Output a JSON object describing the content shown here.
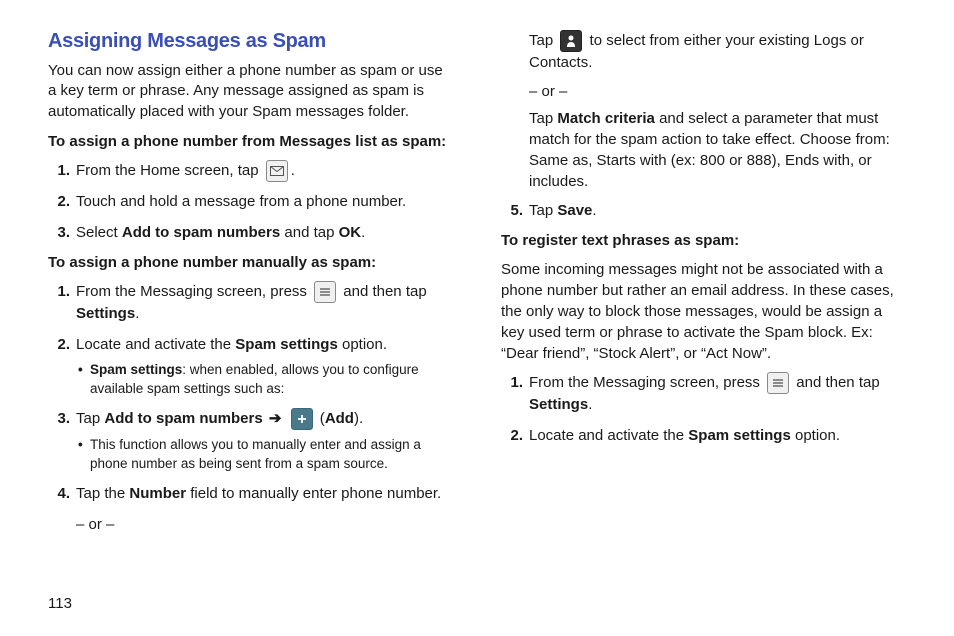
{
  "heading": "Assigning Messages as Spam",
  "intro": "You can now assign either a phone number as spam or use a key term or phrase. Any message assigned as spam is automatically placed with your Spam messages folder.",
  "sub1": "To assign a phone number from Messages list as spam:",
  "s1_1a": "From the Home screen, tap ",
  "s1_1b": ".",
  "s1_2": "Touch and hold a message from a phone number.",
  "s1_3a": "Select ",
  "s1_3b": "Add to spam numbers",
  "s1_3c": " and tap ",
  "s1_3d": "OK",
  "s1_3e": ".",
  "sub2": "To assign a phone number manually as spam:",
  "s2_1a": "From the Messaging screen, press ",
  "s2_1b": " and then tap ",
  "s2_1c": "Settings",
  "s2_1d": ".",
  "s2_2a": "Locate and activate the ",
  "s2_2b": "Spam settings",
  "s2_2c": " option.",
  "s2_2_bul_a": "Spam settings",
  "s2_2_bul_b": ": when enabled, allows you to configure available spam settings such as:",
  "s2_3a": "Tap ",
  "s2_3b": "Add to spam numbers",
  "s2_3c": " ",
  "s2_3arrow": "➔",
  "s2_3d": " (",
  "s2_3e": "Add",
  "s2_3f": ").",
  "s2_3_bul": "This function allows you to manually enter and assign a phone number as being sent from a spam source.",
  "s2_4a": "Tap the ",
  "s2_4b": "Number",
  "s2_4c": " field to manually enter phone number.",
  "or": "– or –",
  "s2_4d": "Tap ",
  "s2_4e": " to select from either your existing Logs or Contacts.",
  "s2_4f": "Tap ",
  "s2_4g": "Match criteria",
  "s2_4h": " and select a parameter that must match for the spam action to take effect. Choose from: Same as, Starts with (ex: 800 or 888), Ends with, or includes.",
  "s2_5a": "Tap ",
  "s2_5b": "Save",
  "s2_5c": ".",
  "sub3": "To register text phrases as spam:",
  "body3": "Some incoming messages might not be associated with a phone number but rather an email address. In these cases, the only way to block those messages, would be assign a key used term or phrase to activate the Spam block. Ex: “Dear friend”, “Stock Alert”, or “Act Now”.",
  "s3_1a": "From the Messaging screen, press ",
  "s3_1b": " and then tap ",
  "s3_1c": "Settings",
  "s3_1d": ".",
  "s3_2a": "Locate and activate the ",
  "s3_2b": "Spam settings",
  "s3_2c": " option.",
  "pageNum": "113",
  "nums": {
    "n1": "1.",
    "n2": "2.",
    "n3": "3.",
    "n4": "4.",
    "n5": "5."
  }
}
